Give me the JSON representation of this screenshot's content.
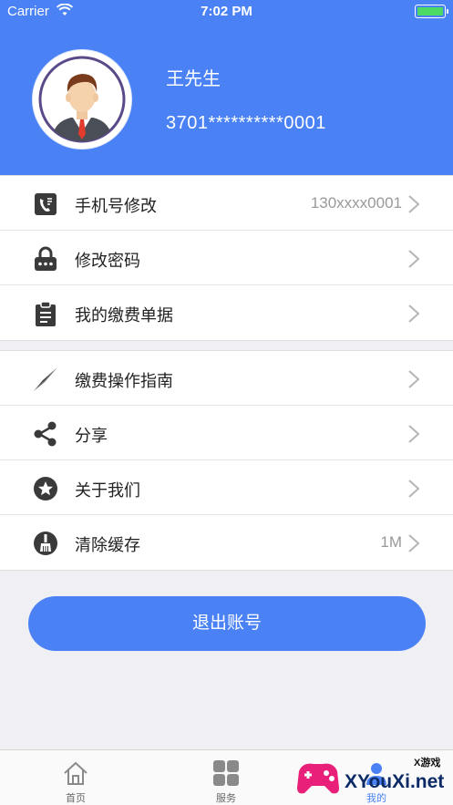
{
  "status_bar": {
    "carrier": "Carrier",
    "time": "7:02 PM"
  },
  "profile": {
    "name": "王先生",
    "id_number": "3701**********0001"
  },
  "menu_group_1": [
    {
      "label": "手机号修改",
      "value": "130xxxx0001",
      "icon": "phone-edit-icon"
    },
    {
      "label": "修改密码",
      "value": "",
      "icon": "lock-icon"
    },
    {
      "label": "我的缴费单据",
      "value": "",
      "icon": "clipboard-icon"
    }
  ],
  "menu_group_2": [
    {
      "label": "缴费操作指南",
      "value": "",
      "icon": "compass-icon"
    },
    {
      "label": "分享",
      "value": "",
      "icon": "share-icon"
    },
    {
      "label": "关于我们",
      "value": "",
      "icon": "star-icon"
    },
    {
      "label": "清除缓存",
      "value": "1M",
      "icon": "broom-icon"
    }
  ],
  "logout_button": {
    "label": "退出账号"
  },
  "tabbar": [
    {
      "label": "首页",
      "icon": "home-icon"
    },
    {
      "label": "服务",
      "icon": "grid-icon"
    },
    {
      "label": "我的",
      "icon": "user-icon"
    }
  ],
  "watermark": {
    "brand": "XYouXi.net",
    "small": "X游戏"
  },
  "colors": {
    "primary": "#4a82f6",
    "background": "#efeff4",
    "icon": "#3a3a3a"
  }
}
